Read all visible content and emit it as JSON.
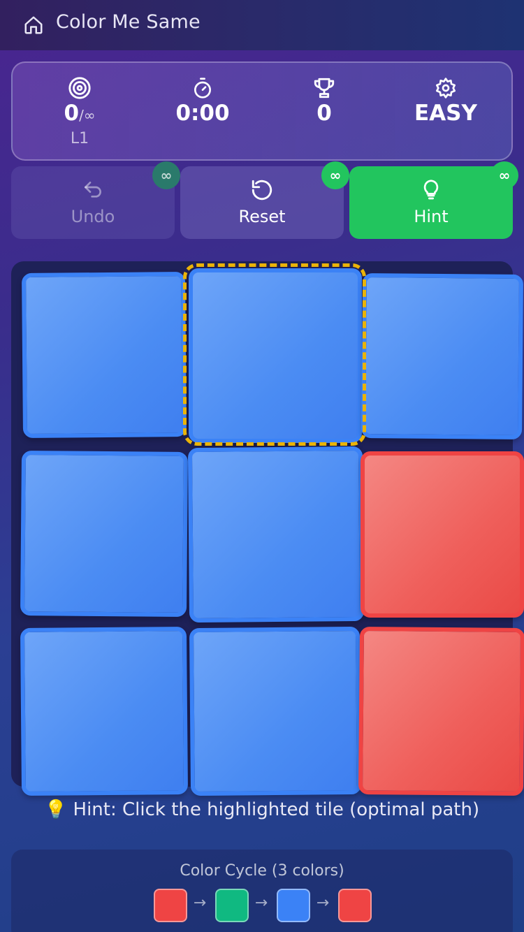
{
  "header": {
    "title": "Color Me Same",
    "home_icon": "home-icon"
  },
  "stats": {
    "moves": {
      "icon": "target-icon",
      "value": "0",
      "limit": "/∞",
      "level": "L1"
    },
    "timer": {
      "icon": "stopwatch-icon",
      "value": "0:00"
    },
    "score": {
      "icon": "trophy-icon",
      "value": "0"
    },
    "difficulty": {
      "icon": "gear-icon",
      "value": "EASY"
    }
  },
  "actions": {
    "undo": {
      "label": "Undo",
      "badge": "∞",
      "enabled": false
    },
    "reset": {
      "label": "Reset",
      "badge": "∞",
      "enabled": true
    },
    "hint": {
      "label": "Hint",
      "badge": "∞",
      "enabled": true
    }
  },
  "board": {
    "rows": 3,
    "cols": 3,
    "tiles": [
      [
        "blue",
        "blue",
        "blue"
      ],
      [
        "blue",
        "blue",
        "red"
      ],
      [
        "blue",
        "blue",
        "red"
      ]
    ],
    "highlighted": {
      "row": 0,
      "col": 1
    }
  },
  "hint_message": "💡 Hint: Click the highlighted tile (optimal path)",
  "color_cycle": {
    "title": "Color Cycle (3 colors)",
    "colors": [
      "#ef4444",
      "#10b981",
      "#3b82f6",
      "#ef4444"
    ],
    "arrow": "→"
  },
  "palette": {
    "blue": "#3b82f6",
    "red": "#ef4444",
    "green": "#22c55e",
    "highlight": "#eab308"
  }
}
